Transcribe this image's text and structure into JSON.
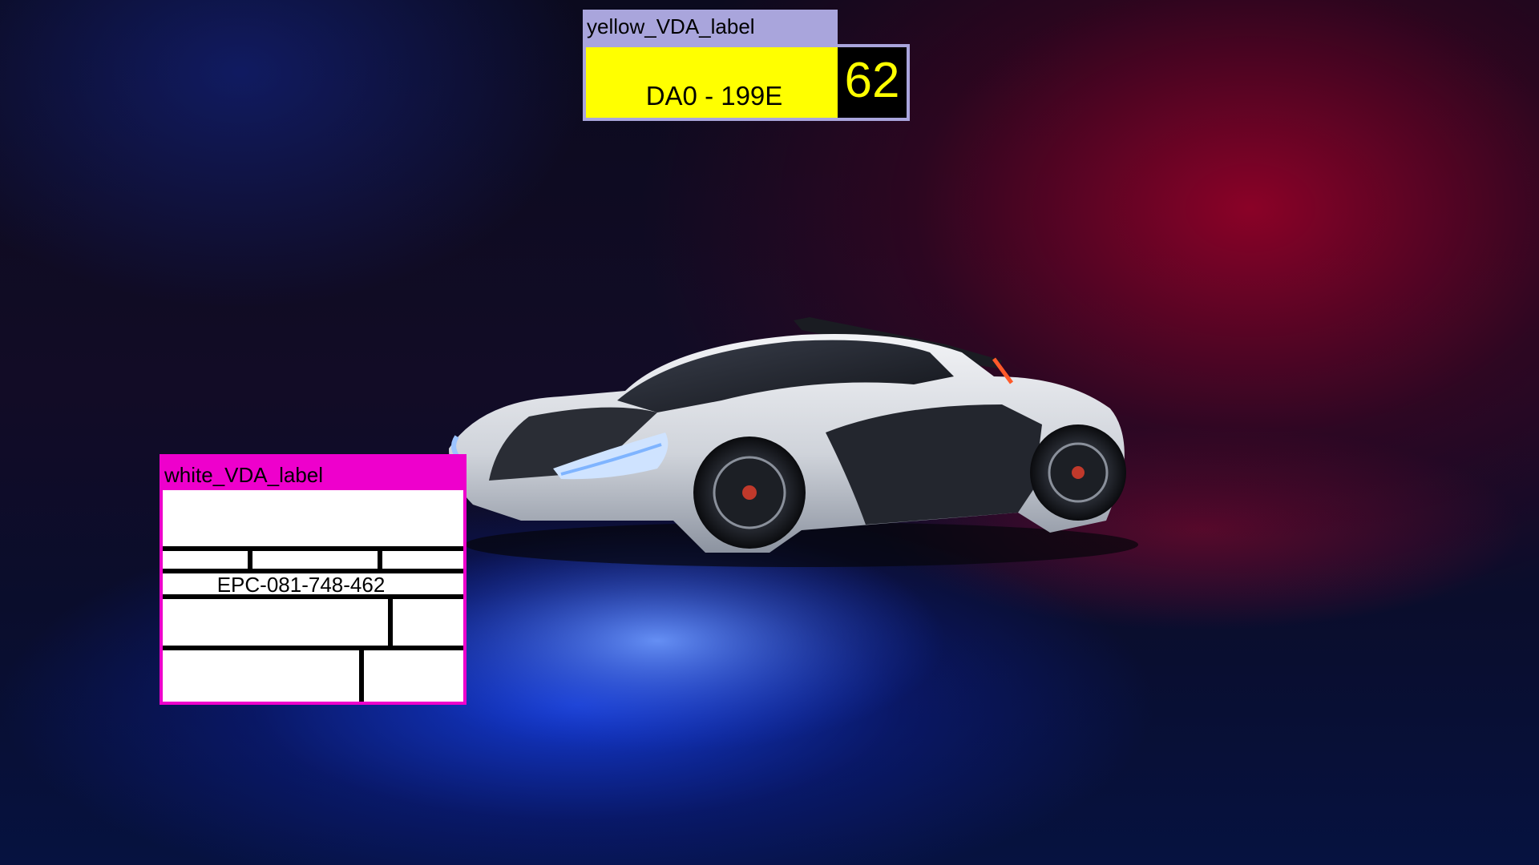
{
  "scene": {
    "image_subject": "sports-car-icon"
  },
  "yellow_label": {
    "title": "yellow_VDA_label",
    "code": "DA0 - 199E",
    "number": "62",
    "colors": {
      "header": "#a9a5dc",
      "body": "#ffff00",
      "number_bg": "#000000",
      "number_fg": "#ffff00"
    }
  },
  "white_label": {
    "title": "white_VDA_label",
    "epc": "EPC-081-748-462",
    "colors": {
      "header": "#ee00cc",
      "body": "#ffffff"
    }
  }
}
